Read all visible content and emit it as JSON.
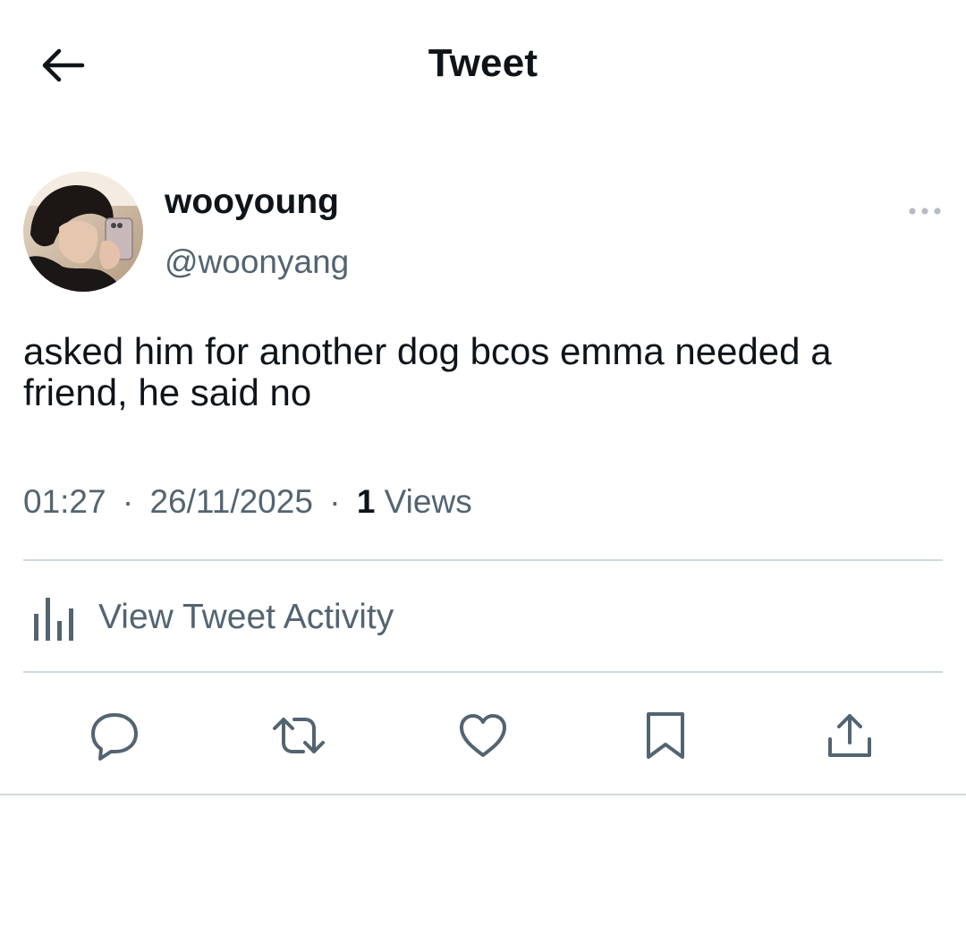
{
  "header": {
    "title": "Tweet",
    "back_icon": "arrow-left-icon"
  },
  "author": {
    "display_name": "wooyoung",
    "handle": "@woonyang",
    "avatar_icon": "avatar-photo",
    "more_icon": "more-horizontal-icon"
  },
  "tweet": {
    "text": "asked him for another dog bcos emma needed a friend, he said no"
  },
  "meta": {
    "time": "01:27",
    "separator": "·",
    "date": "26/11/2025",
    "views_count": "1",
    "views_label": "Views"
  },
  "activity": {
    "label": "View Tweet Activity",
    "icon": "bar-chart-icon"
  },
  "actions": [
    {
      "name": "reply",
      "icon": "reply-icon"
    },
    {
      "name": "retweet",
      "icon": "retweet-icon"
    },
    {
      "name": "like",
      "icon": "heart-icon"
    },
    {
      "name": "bookmark",
      "icon": "bookmark-icon"
    },
    {
      "name": "share",
      "icon": "share-icon"
    }
  ],
  "colors": {
    "text_primary": "#0f1419",
    "text_secondary": "#536471",
    "divider": "#cfd9de",
    "background": "#ffffff"
  }
}
